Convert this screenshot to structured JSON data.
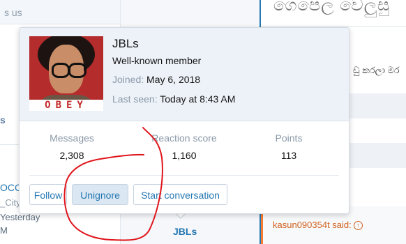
{
  "background": {
    "left_top_text": "s  us",
    "left_letter": "s",
    "left_name_partial": "OCC",
    "left_location_partial": "_City",
    "left_time": "Yesterday",
    "left_time_suffix": "M",
    "right_top_text": "ගෙපෙල වෙලුසු",
    "right_mid_text": "ඩු කරලා මර",
    "quote_author": "kasun090354t said:",
    "bottom_username": "JBLs"
  },
  "profile": {
    "username": "JBLs",
    "user_title": "Well-known member",
    "joined_label": "Joined:",
    "joined_value": "May 6, 2018",
    "last_seen_label": "Last seen:",
    "last_seen_value": "Today at 8:43 AM",
    "avatar_caption": "OBEY"
  },
  "stats": [
    {
      "label": "Messages",
      "value": "2,308"
    },
    {
      "label": "Reaction score",
      "value": "1,160"
    },
    {
      "label": "Points",
      "value": "113"
    }
  ],
  "buttons": {
    "follow": "Follow",
    "unignore": "Unignore",
    "start_conversation": "Start conversation"
  },
  "colors": {
    "link": "#2577b1",
    "muted": "#8c9aa9",
    "header_bg": "#edf2f8",
    "annotation": "#e0141b",
    "quote_accent": "#f87c30"
  }
}
